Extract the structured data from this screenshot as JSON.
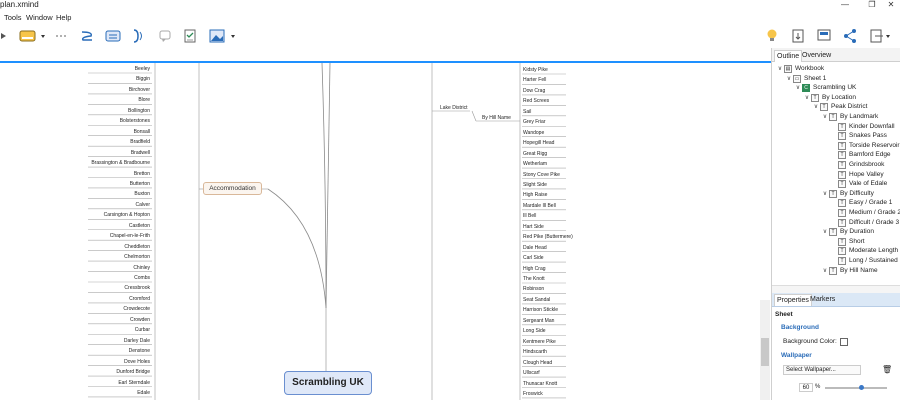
{
  "window": {
    "title": "plan.xmind",
    "controls": [
      "—",
      "❐",
      "✕"
    ]
  },
  "menu": [
    "Tools",
    "Window",
    "Help"
  ],
  "toolbar": {
    "icons": [
      "play-icon",
      "topic-icon",
      "more-icon",
      "relationship-icon",
      "boundary-icon",
      "summary-icon",
      "callout-icon",
      "task-icon",
      "image-icon",
      "idea-icon",
      "export-icon",
      "presentation-icon",
      "share-icon",
      "new-icon",
      "tab-icon"
    ]
  },
  "canvas": {
    "root": "Scrambling UK",
    "accommodation": "Accommodation",
    "lake_district": "Lake District",
    "by_hill_name": "By Hill Name",
    "left_leaves": [
      "Beeley",
      "Biggin",
      "Birchover",
      "Blore",
      "Bollington",
      "Bolsterstones",
      "Bonsall",
      "Bradfield",
      "Bradwell",
      "Brassington & Bradbourne",
      "Bretton",
      "Butterton",
      "Buxton",
      "Calver",
      "Carsington & Hopton",
      "Castleton",
      "Chapel-en-le-Frith",
      "Cheddleton",
      "Chelmorton",
      "Chinley",
      "Combs",
      "Cressbrook",
      "Cromford",
      "Crowdecote",
      "Crowden",
      "Curbar",
      "Darley Dale",
      "Denstone",
      "Dove Holes",
      "Dunford Bridge",
      "Earl Sterndale",
      "Edale"
    ],
    "right_leaves": [
      "Kidsty Pike",
      "Harter Fell",
      "Dow Crag",
      "Red Screes",
      "Sail",
      "Grey Friar",
      "Wandope",
      "Hopegill Head",
      "Great Rigg",
      "Wetherlam",
      "Stony Cove Pike",
      "Slight Side",
      "High Raise",
      "Mardale Ill Bell",
      "Ill Bell",
      "Hart Side",
      "Red Pike (Buttermere)",
      "Dale Head",
      "Carl Side",
      "High Crag",
      "The Knott",
      "Robinson",
      "Seat Sandal",
      "Harrison Stickle",
      "Sergeant Man",
      "Long Side",
      "Kentmere Pike",
      "Hindscarth",
      "Clough Head",
      "Ullscarf",
      "Thunacar Knott",
      "Froswick"
    ]
  },
  "panel": {
    "tabs": [
      "Outline",
      "Overview"
    ],
    "outline": [
      {
        "label": "Workbook",
        "depth": 0,
        "toggle": "∨",
        "icon": "workbook"
      },
      {
        "label": "Sheet 1",
        "depth": 1,
        "toggle": "∨",
        "icon": "sheet"
      },
      {
        "label": "Scrambling UK",
        "depth": 2,
        "toggle": "∨",
        "icon": "central"
      },
      {
        "label": "By Location",
        "depth": 3,
        "toggle": "∨",
        "icon": "topic"
      },
      {
        "label": "Peak District",
        "depth": 4,
        "toggle": "∨",
        "icon": "topic"
      },
      {
        "label": "By Landmark",
        "depth": 5,
        "toggle": "∨",
        "icon": "topic"
      },
      {
        "label": "Kinder Downfall",
        "depth": 6,
        "toggle": "",
        "icon": "topic"
      },
      {
        "label": "Snakes Pass",
        "depth": 6,
        "toggle": "",
        "icon": "topic"
      },
      {
        "label": "Torside Reservoir",
        "depth": 6,
        "toggle": "",
        "icon": "topic"
      },
      {
        "label": "Bamford Edge",
        "depth": 6,
        "toggle": "",
        "icon": "topic"
      },
      {
        "label": "Grindsbrook",
        "depth": 6,
        "toggle": "",
        "icon": "topic"
      },
      {
        "label": "Hope Valley",
        "depth": 6,
        "toggle": "",
        "icon": "topic"
      },
      {
        "label": "Vale of Edale",
        "depth": 6,
        "toggle": "",
        "icon": "topic"
      },
      {
        "label": "By Difficulty",
        "depth": 5,
        "toggle": "∨",
        "icon": "topic"
      },
      {
        "label": "Easy / Grade 1",
        "depth": 6,
        "toggle": "",
        "icon": "topic"
      },
      {
        "label": "Medium / Grade 2",
        "depth": 6,
        "toggle": "",
        "icon": "topic"
      },
      {
        "label": "Difficult / Grade 3",
        "depth": 6,
        "toggle": "",
        "icon": "topic"
      },
      {
        "label": "By Duration",
        "depth": 5,
        "toggle": "∨",
        "icon": "topic"
      },
      {
        "label": "Short",
        "depth": 6,
        "toggle": "",
        "icon": "topic"
      },
      {
        "label": "Moderate Length",
        "depth": 6,
        "toggle": "",
        "icon": "topic"
      },
      {
        "label": "Long / Sustained",
        "depth": 6,
        "toggle": "",
        "icon": "topic"
      },
      {
        "label": "By Hill Name",
        "depth": 5,
        "toggle": "∨",
        "icon": "topic"
      }
    ],
    "props_tabs": [
      "Properties",
      "Markers"
    ],
    "props": {
      "sheet": "Sheet",
      "background": "Background",
      "background_color": "Background Color:",
      "wallpaper": "Wallpaper",
      "select_wallpaper": "Select Wallpaper...",
      "opacity": "60",
      "opacity_unit": "%"
    }
  },
  "colors": {
    "accent": "#1e90ff",
    "root_fill": "#dfe8f8",
    "root_border": "#6a8fd0",
    "accommodation_fill": "#fbf5ef",
    "accommodation_border": "#d9b89a",
    "props_tab_bg": "#dbe8f6",
    "section_text": "#2a6cb8"
  }
}
